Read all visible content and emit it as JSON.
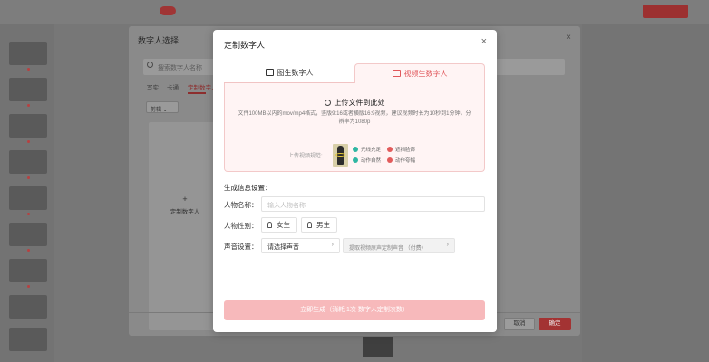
{
  "mid_dialog": {
    "title": "数字人选择",
    "search_placeholder": "搜索数字人名称",
    "tabs": [
      "写实",
      "卡通",
      "定制数字人"
    ],
    "filter_label": "剪辑",
    "create_card_plus": "+",
    "create_card_label": "定制数字人",
    "cancel_label": "取消",
    "confirm_label": "确定"
  },
  "modal": {
    "title": "定制数字人",
    "close": "×",
    "tabs": {
      "image_label": "图生数字人",
      "video_label": "视频生数字人"
    },
    "upload": {
      "title": "上传文件到此处",
      "description": "文件100MB以内的mov/mp4格式，竖版9:16或者横版16:9视频，建议视频时长为10秒到1分钟，分辨率为1080p",
      "example_label": "上传视频规范:",
      "checks": {
        "good": [
          "光线充足",
          "动作自然"
        ],
        "bad": [
          "遮挡脸部",
          "动作夸幅"
        ]
      }
    },
    "section_title": "生成信息设置：",
    "name": {
      "label": "人物名称：",
      "placeholder": "输入人物名称"
    },
    "gender": {
      "label": "人物性别：",
      "female": "女生",
      "male": "男生"
    },
    "voice": {
      "label": "声音设置：",
      "select_value": "请选择声音",
      "chevron": "›",
      "custom_label": "提取视频原声定制声音 （付费）"
    },
    "generate_button": "立即生成（消耗 1次 数字人定制次数）"
  },
  "colors": {
    "accent": "#e0575b",
    "accent_light": "#f7b9bb",
    "check_ok": "#2fb6a2",
    "check_bad": "#e25b5b"
  }
}
